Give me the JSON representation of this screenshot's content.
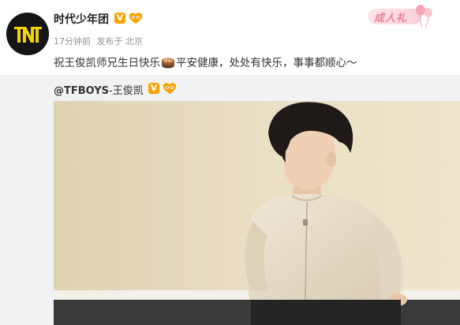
{
  "post": {
    "username": "时代少年团",
    "verified_mark": "V",
    "fan_badge_icon": "fan-badge-icon",
    "time": "17分钟前",
    "location": "发布于 北京",
    "event_label": "成人礼",
    "text_before": "祝王俊凯师兄生日快乐",
    "emoji": "cake-emoji-icon",
    "text_after": "平安健康，处处有快乐，事事都顺心～"
  },
  "repost": {
    "handle": "@TFBOYS",
    "separator": "-",
    "name": "王俊凯",
    "verified_mark": "V",
    "image_alt": "photo"
  },
  "colors": {
    "accent_badge": "#f7a400",
    "event_pink": "#ef7e96",
    "repost_bg": "#f2f2f5",
    "meta_gray": "#939393"
  }
}
